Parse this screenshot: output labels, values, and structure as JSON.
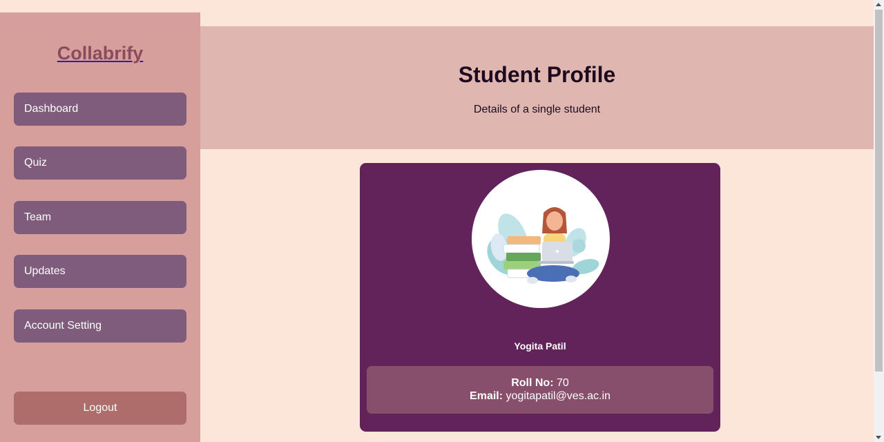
{
  "sidebar": {
    "logo": "Collabrify",
    "items": [
      {
        "label": "Dashboard"
      },
      {
        "label": "Quiz"
      },
      {
        "label": "Team"
      },
      {
        "label": "Updates"
      },
      {
        "label": "Account Setting"
      }
    ],
    "logout": "Logout"
  },
  "header": {
    "title": "Student Profile",
    "subtitle": "Details of a single student"
  },
  "profile": {
    "name": "Yogita Patil",
    "roll_label": "Roll No:",
    "roll_value": "70",
    "email_label": "Email:",
    "email_value": "yogitapatil@ves.ac.in",
    "avatar_icon": "student-with-laptop-illustration"
  },
  "colors": {
    "background": "#fce6d9",
    "sidebar": "#d69f9b",
    "nav_button": "#7f5b7c",
    "logout_button": "#ae6d6b",
    "header": "#e0b6b1",
    "card": "#61235a",
    "info_box": "#874f6c"
  }
}
